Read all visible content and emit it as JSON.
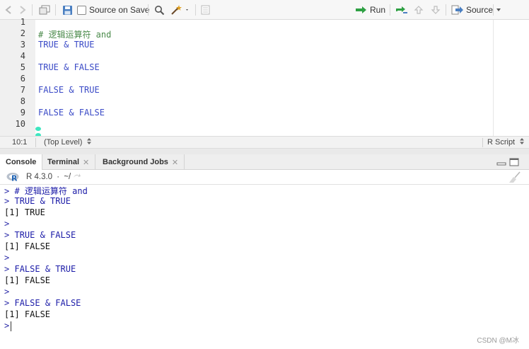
{
  "toolbar": {
    "source_on_save_label": "Source on Save",
    "run_label": "Run",
    "source_label": "Source"
  },
  "editor": {
    "lines": [
      {
        "num": "1",
        "text": ""
      },
      {
        "num": "2",
        "text": "# 逻辑运算符 and",
        "kind": "comment"
      },
      {
        "num": "3",
        "text": "TRUE & TRUE",
        "kind": "code"
      },
      {
        "num": "4",
        "text": ""
      },
      {
        "num": "5",
        "text": "TRUE & FALSE",
        "kind": "code"
      },
      {
        "num": "6",
        "text": ""
      },
      {
        "num": "7",
        "text": "FALSE & TRUE",
        "kind": "code"
      },
      {
        "num": "8",
        "text": ""
      },
      {
        "num": "9",
        "text": "FALSE & FALSE",
        "kind": "code"
      },
      {
        "num": "10",
        "text": ""
      }
    ]
  },
  "statusbar": {
    "position": "10:1",
    "scope": "(Top Level)",
    "file_type": "R Script"
  },
  "tabs": [
    {
      "label": "Console",
      "active": true
    },
    {
      "label": "Terminal",
      "closable": true
    },
    {
      "label": "Background Jobs",
      "closable": true
    }
  ],
  "console_header": {
    "version": "R 4.3.0",
    "sep": "·",
    "path": "~/"
  },
  "console": {
    "prompt": ">",
    "lines": [
      {
        "type": "input",
        "text": "# 逻辑运算符 and"
      },
      {
        "type": "input",
        "text": "TRUE & TRUE"
      },
      {
        "type": "output",
        "text": "[1] TRUE"
      },
      {
        "type": "input",
        "text": ""
      },
      {
        "type": "input",
        "text": "TRUE & FALSE"
      },
      {
        "type": "output",
        "text": "[1] FALSE"
      },
      {
        "type": "input",
        "text": ""
      },
      {
        "type": "input",
        "text": "FALSE & TRUE"
      },
      {
        "type": "output",
        "text": "[1] FALSE"
      },
      {
        "type": "input",
        "text": ""
      },
      {
        "type": "input",
        "text": "FALSE & FALSE"
      },
      {
        "type": "output",
        "text": "[1] FALSE"
      },
      {
        "type": "input",
        "text": "",
        "cursor": true
      }
    ]
  },
  "watermark": "CSDN @M冰",
  "colors": {
    "code_keyword": "#3b4bc7",
    "comment": "#4a8a4a",
    "console_input": "#1c1ca8",
    "run_arrow": "#2ea043"
  }
}
